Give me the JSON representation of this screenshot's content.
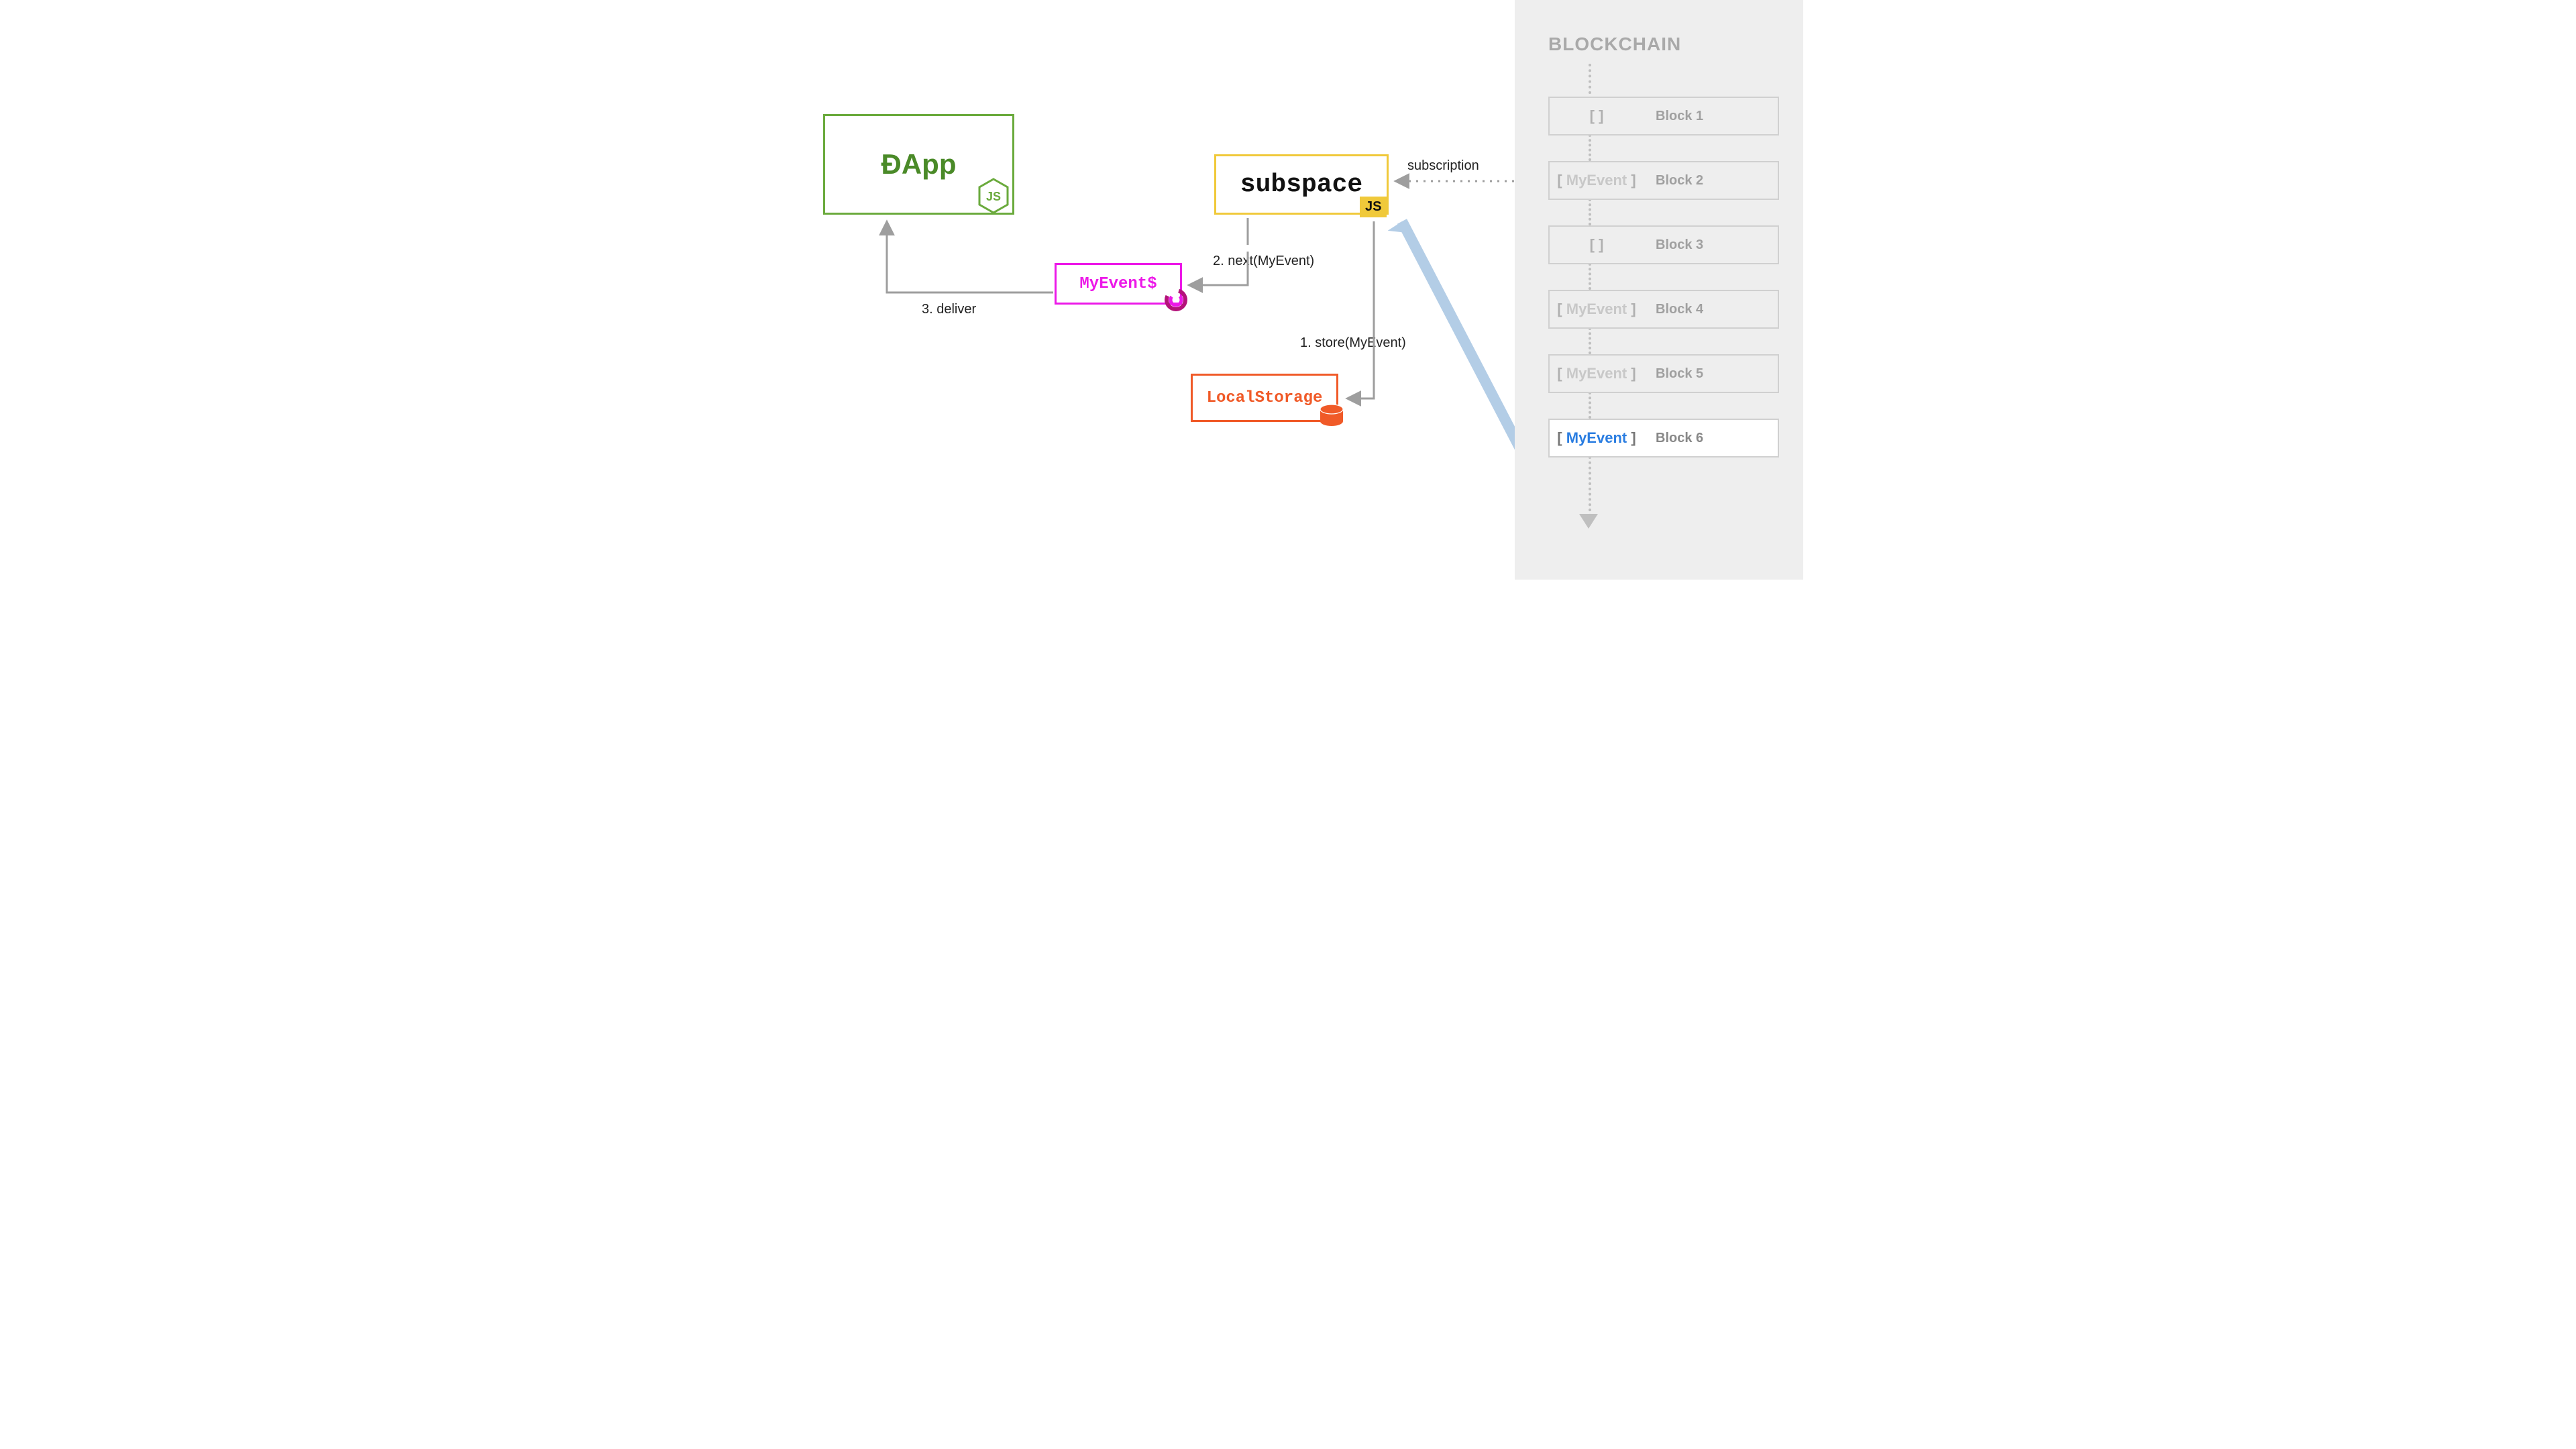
{
  "nodes": {
    "dapp": "ÐApp",
    "subspace": "subspace",
    "subspace_badge": "JS",
    "observable": "MyEvent$",
    "localstorage": "LocalStorage"
  },
  "labels": {
    "subscription": "subscription",
    "step1": "1. store(MyEvent)",
    "step2": "2. next(MyEvent)",
    "step3": "3. deliver"
  },
  "blockchain": {
    "title": "BLOCKCHAIN",
    "blocks": [
      {
        "name": "Block 1",
        "event": "",
        "active": false
      },
      {
        "name": "Block 2",
        "event": "MyEvent",
        "active": false
      },
      {
        "name": "Block 3",
        "event": "",
        "active": false
      },
      {
        "name": "Block 4",
        "event": "MyEvent",
        "active": false
      },
      {
        "name": "Block 5",
        "event": "MyEvent",
        "active": false
      },
      {
        "name": "Block 6",
        "event": "MyEvent",
        "active": true
      }
    ]
  },
  "colors": {
    "green": "#6aaa3c",
    "yellow": "#f0c93a",
    "magenta": "#ec18e8",
    "orange": "#f05a28",
    "grey": "#9e9e9e",
    "arrowBlue": "#b3cde6",
    "blueText": "#2a7de1",
    "panel": "#eeeeee"
  }
}
